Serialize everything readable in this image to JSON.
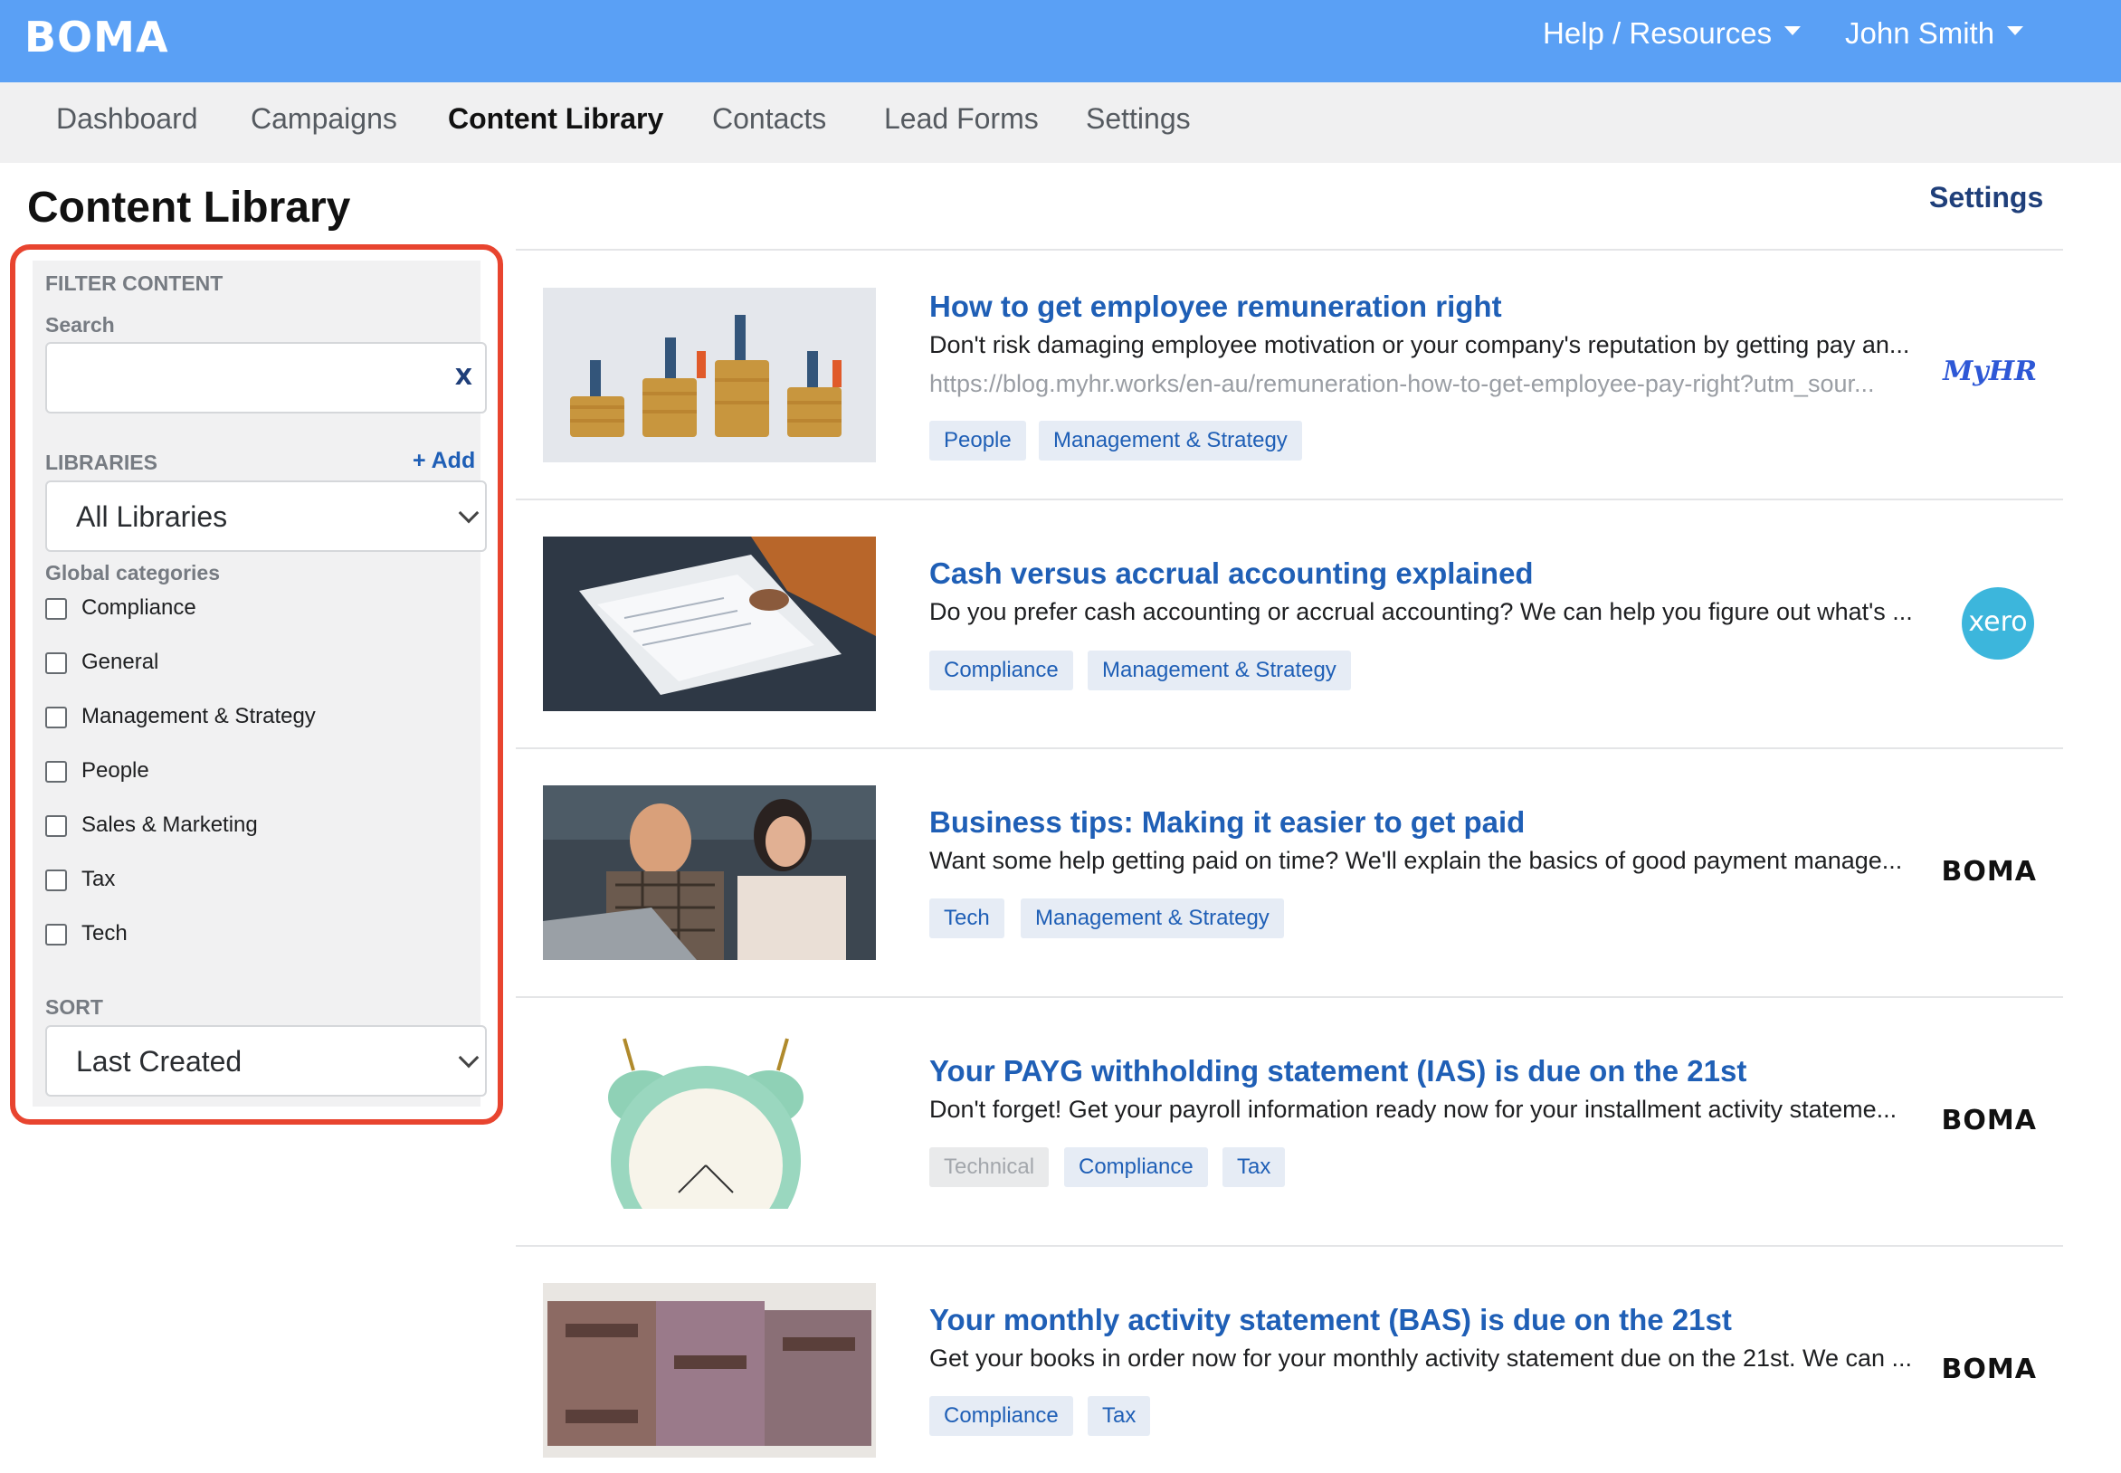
{
  "app": {
    "logo": "BOMA"
  },
  "topnav": {
    "help": "Help / Resources",
    "user": "John Smith"
  },
  "tabs": [
    {
      "label": "Dashboard"
    },
    {
      "label": "Campaigns"
    },
    {
      "label": "Content Library"
    },
    {
      "label": "Contacts"
    },
    {
      "label": "Lead Forms"
    },
    {
      "label": "Settings"
    }
  ],
  "page": {
    "title": "Content Library",
    "settings_link": "Settings"
  },
  "filter": {
    "heading": "FILTER CONTENT",
    "search_label": "Search",
    "search_value": "",
    "search_clear": "X",
    "libraries_label": "LIBRARIES",
    "add_label": "+ Add",
    "library_selected": "All Libraries",
    "global_categories_label": "Global categories",
    "categories": [
      {
        "label": "Compliance",
        "checked": false
      },
      {
        "label": "General",
        "checked": false
      },
      {
        "label": "Management & Strategy",
        "checked": false
      },
      {
        "label": "People",
        "checked": false
      },
      {
        "label": "Sales & Marketing",
        "checked": false
      },
      {
        "label": "Tax",
        "checked": false
      },
      {
        "label": "Tech",
        "checked": false
      }
    ],
    "sort_label": "SORT",
    "sort_selected": "Last Created"
  },
  "articles": [
    {
      "title": "How to get employee remuneration right",
      "description": "Don't risk damaging employee motivation or your company's reputation by getting pay an...",
      "url": "https://blog.myhr.works/en-au/remuneration-how-to-get-employee-pay-right?utm_sour...",
      "tags": [
        "People",
        "Management & Strategy"
      ],
      "brand": "MyHR"
    },
    {
      "title": "Cash versus accrual accounting explained",
      "description": "Do you prefer cash accounting or accrual accounting? We can help you figure out what's ...",
      "tags": [
        "Compliance",
        "Management & Strategy"
      ],
      "brand": "xero"
    },
    {
      "title": "Business tips: Making it easier to get paid",
      "description": "Want some help getting paid on time? We'll explain the basics of good payment manage...",
      "tags": [
        "Tech",
        "Management & Strategy"
      ],
      "brand": "BOMA"
    },
    {
      "title": "Your PAYG withholding statement (IAS) is due on the 21st",
      "description": "Don't forget! Get your payroll information ready now for your installment activity stateme...",
      "tags": [
        "Technical",
        "Compliance",
        "Tax"
      ],
      "brand": "BOMA"
    },
    {
      "title": "Your monthly activity statement (BAS) is due on the 21st",
      "description": "Get your books in order now for your monthly activity statement due on the 21st. We can ...",
      "tags": [
        "Compliance",
        "Tax"
      ],
      "brand": "BOMA"
    }
  ],
  "colors": {
    "topbar": "#5aa0f5",
    "link": "#1f5fb6",
    "highlight_border": "#e8442f",
    "tag_bg": "#e6ecf5"
  }
}
